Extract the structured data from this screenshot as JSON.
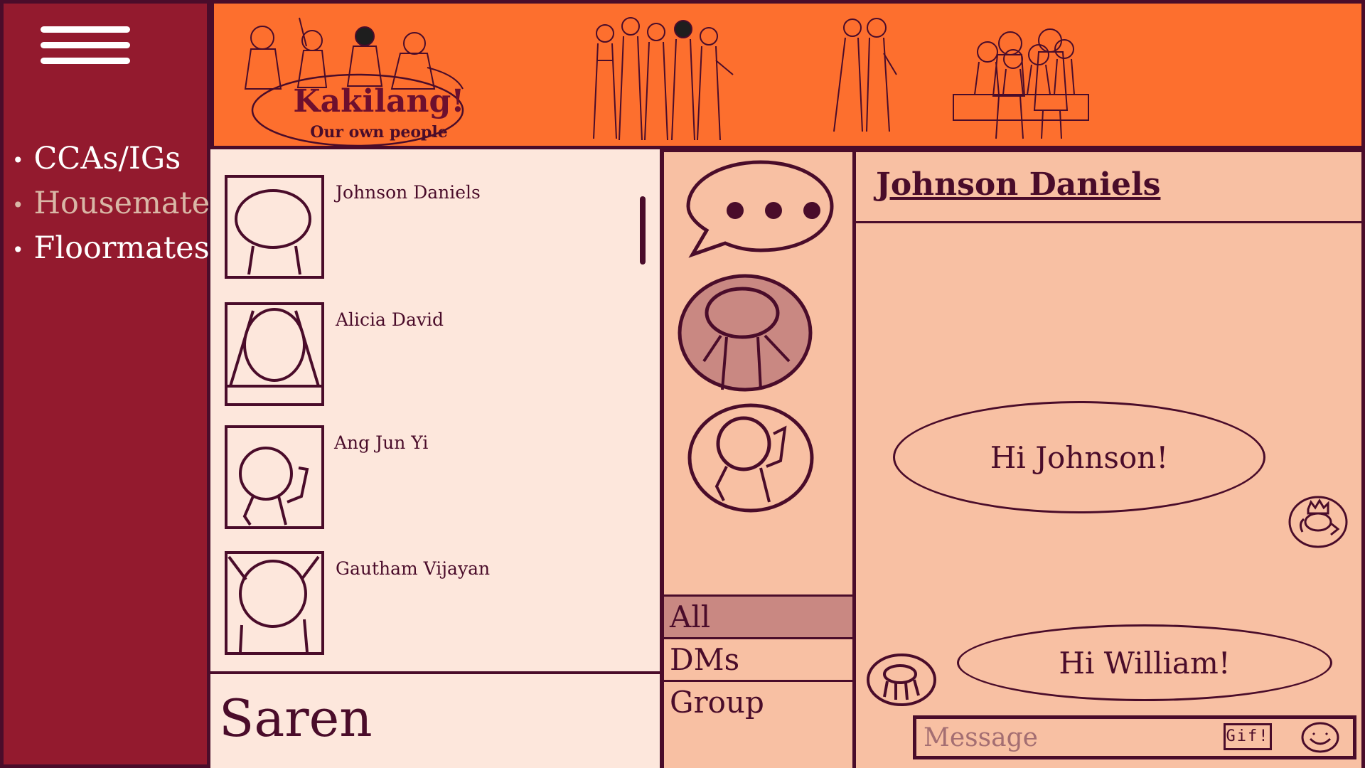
{
  "sidebar": {
    "items": [
      {
        "label": "CCAs/IGs",
        "active": false
      },
      {
        "label": "Housemates",
        "active": true
      },
      {
        "label": "Floormates",
        "active": false
      }
    ]
  },
  "banner": {
    "title": "Kakilang!",
    "subtitle": "Our own people"
  },
  "contacts": {
    "list": [
      {
        "name": "Johnson Daniels"
      },
      {
        "name": "Alicia David"
      },
      {
        "name": "Ang Jun Yi"
      },
      {
        "name": "Gautham Vijayan"
      }
    ],
    "group_label": "Saren"
  },
  "filters": [
    "All",
    "DMs",
    "Group"
  ],
  "chat": {
    "title": "Johnson Daniels",
    "messages": [
      {
        "text": "Hi Johnson!",
        "from": "self"
      },
      {
        "text": "Hi William!",
        "from": "other"
      }
    ],
    "input_placeholder": "Message",
    "gif_label": "Gif!"
  },
  "colors": {
    "sidebar": "#931a2e",
    "banner": "#fd6f2e",
    "contacts_bg": "#fde7dc",
    "chat_bg": "#f8c0a3",
    "accent": "#4a0c2a",
    "active_filter": "#c98882"
  }
}
